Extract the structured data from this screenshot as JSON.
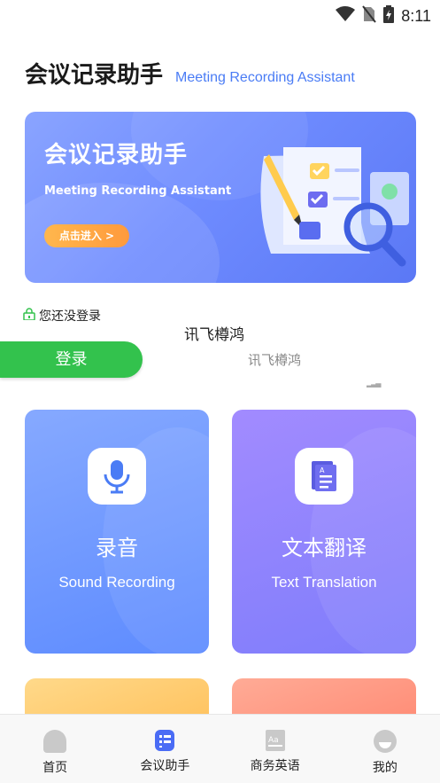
{
  "status_bar": {
    "time": "8:11"
  },
  "header": {
    "title": "会议记录助手",
    "subtitle": "Meeting Recording Assistant"
  },
  "banner": {
    "title": "会议记录助手",
    "subtitle": "Meeting Recording Assistant",
    "button_label": "点击进入 >"
  },
  "login": {
    "status_text": "您还没登录",
    "button_label": "登录"
  },
  "brand": {
    "name_primary": "讯飞樽鸿",
    "name_secondary": "讯飞樽鸿"
  },
  "cards": [
    {
      "title": "录音",
      "subtitle": "Sound Recording",
      "icon": "microphone-icon"
    },
    {
      "title": "文本翻译",
      "subtitle": "Text Translation",
      "icon": "document-icon"
    }
  ],
  "tabbar": {
    "items": [
      {
        "label": "首页",
        "icon": "home-icon"
      },
      {
        "label": "会议助手",
        "icon": "meeting-list-icon",
        "active": true
      },
      {
        "label": "商务英语",
        "icon": "dictionary-icon"
      },
      {
        "label": "我的",
        "icon": "profile-icon"
      }
    ]
  },
  "colors": {
    "accent_blue": "#4a7cf5",
    "login_green": "#33c24d",
    "active_tab": "#4a6cf5"
  }
}
